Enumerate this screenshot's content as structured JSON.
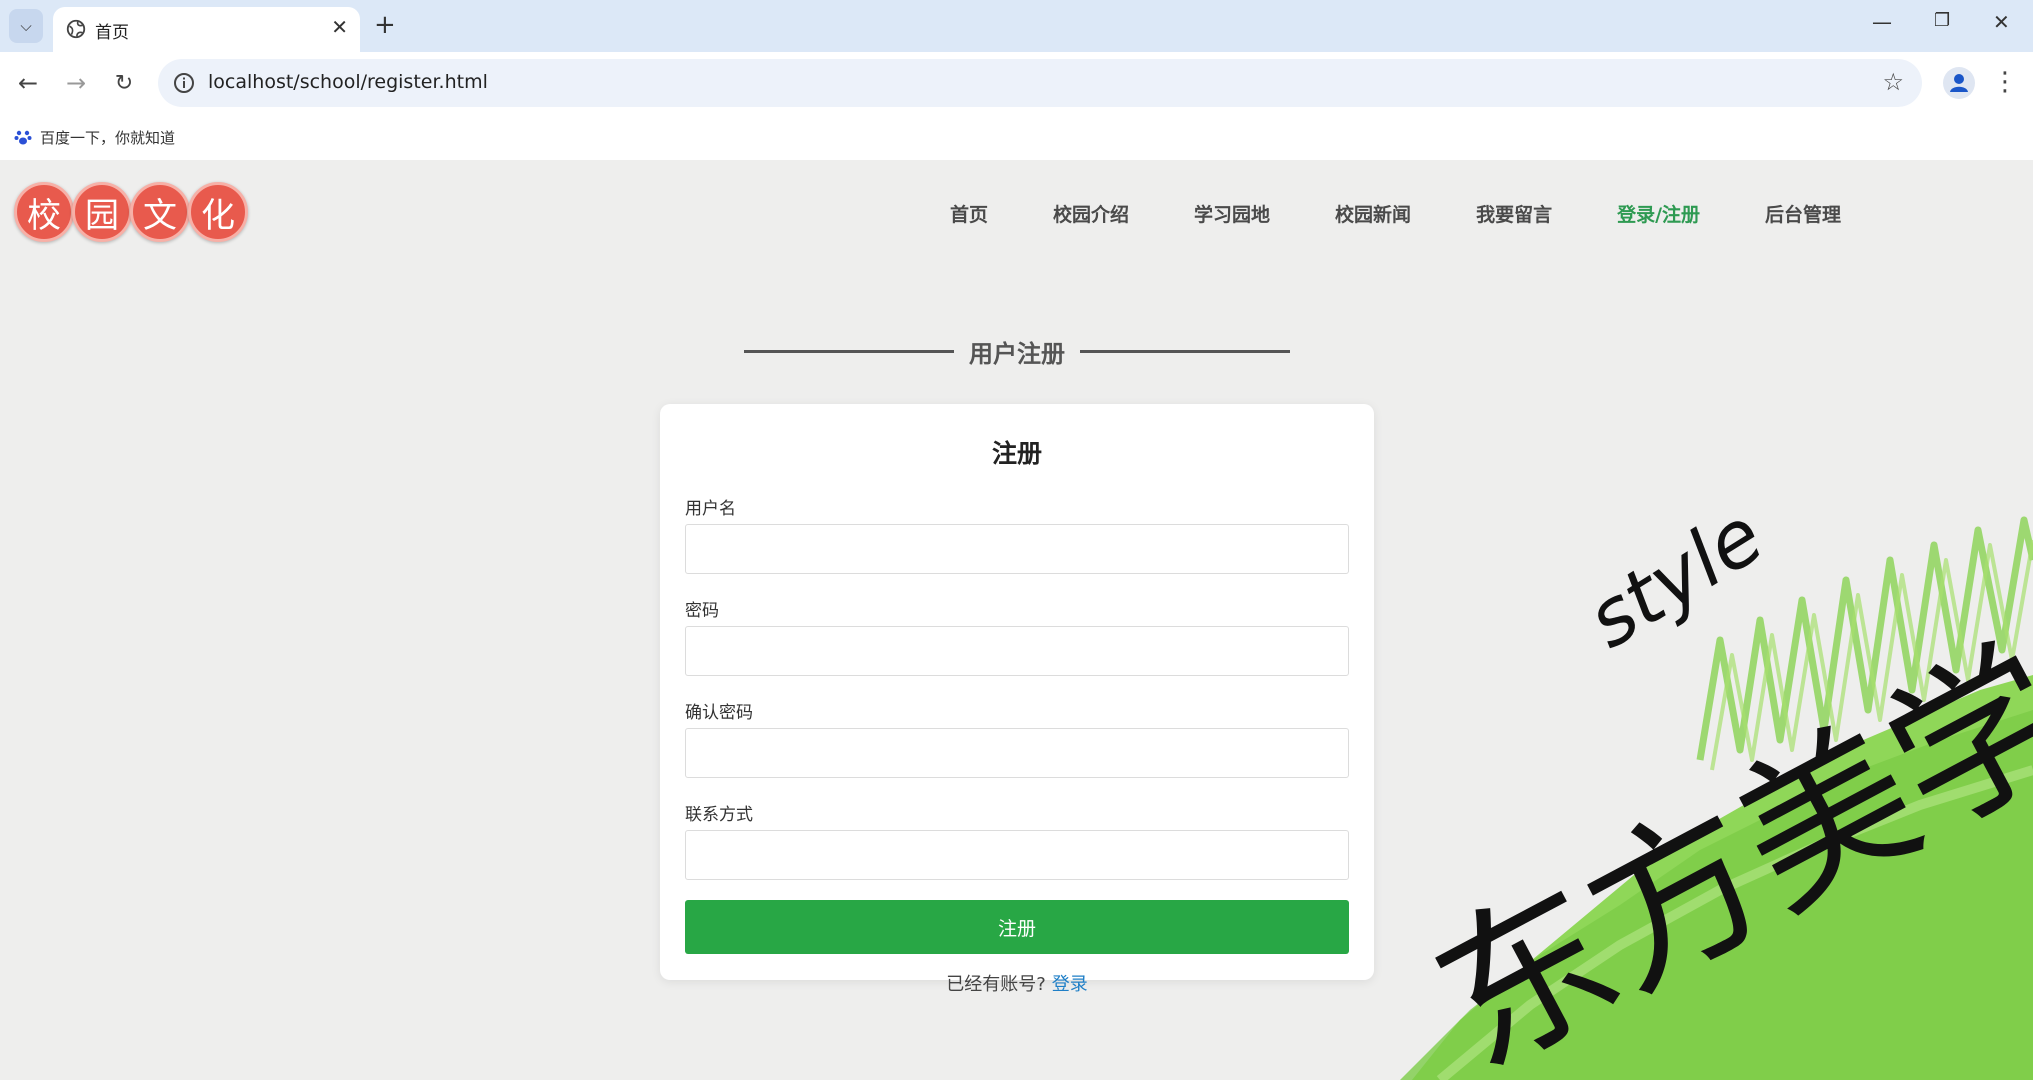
{
  "browser": {
    "tab_title": "首页",
    "url": "localhost/school/register.html",
    "bookmark": "百度一下，你就知道"
  },
  "site": {
    "logo_chars": [
      "校",
      "园",
      "文",
      "化"
    ],
    "nav": [
      "首页",
      "校园介绍",
      "学习园地",
      "校园新闻",
      "我要留言",
      "登录/注册",
      "后台管理"
    ],
    "active_nav": "登录/注册",
    "accent_color": "#2e9a52",
    "logo_color": "#e85a4d"
  },
  "section_title": "用户注册",
  "form": {
    "title": "注册",
    "fields": [
      {
        "label": "用户名",
        "value": ""
      },
      {
        "label": "密码",
        "value": ""
      },
      {
        "label": "确认密码",
        "value": ""
      },
      {
        "label": "联系方式",
        "value": ""
      }
    ],
    "submit_label": "注册",
    "submit_color": "#28a745",
    "login_prompt": "已经有账号?",
    "login_link": "登录"
  },
  "decoration": {
    "text_latin": "style",
    "text_cjk": "东方美学"
  }
}
